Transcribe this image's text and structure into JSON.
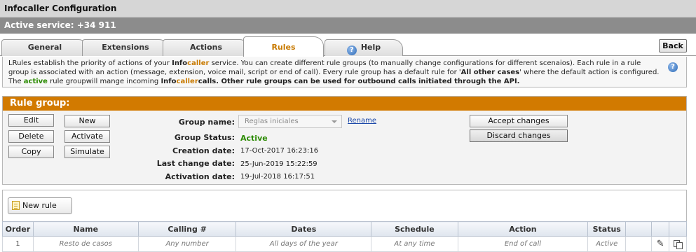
{
  "window": {
    "title": "Infocaller Configuration",
    "active_service": "Active service: +34 911"
  },
  "tabs": [
    {
      "label": "General",
      "active": false
    },
    {
      "label": "Extensions",
      "active": false
    },
    {
      "label": "Actions",
      "active": false
    },
    {
      "label": "Rules",
      "active": true
    },
    {
      "label": "Help",
      "active": false,
      "icon": "help-icon"
    }
  ],
  "back_label": "Back",
  "info": {
    "part1": "LRules establish the priority of actions of your ",
    "brand_a": "Info",
    "brand_b": "caller",
    "part2": " service. You can create different rule groups (to manually change configurations for different scenaios). Each rule in a rule group is associated with an action (message, extension, voice mail, script or end of call). Every rule group has a default rule for '",
    "bold1": "All other cases",
    "part3": "' where the default action is configured. The ",
    "active_word": "active",
    "part4": " rule groupwill mange incoming ",
    "brand_a2": "Info",
    "brand_b2": "caller",
    "bold2": "calls. Other rule groups can be used for outbound calls initiated through the API."
  },
  "rule_group": {
    "header": "Rule group:",
    "buttons": {
      "edit": "Edit",
      "new": "New",
      "delete": "Delete",
      "activate": "Activate",
      "copy": "Copy",
      "simulate": "Simulate",
      "accept": "Accept changes",
      "discard": "Discard changes"
    },
    "labels": {
      "group_name": "Group name:",
      "group_status": "Group Status:",
      "creation_date": "Creation date:",
      "last_change_date": "Last change date:",
      "activation_date": "Activation date:"
    },
    "group_name_value": "Reglas iniciales",
    "rename_label": "Rename",
    "group_status_value": "Active",
    "creation_date_value": "17-Oct-2017 16:23:16",
    "last_change_date_value": "25-Jun-2019 15:22:59",
    "activation_date_value": "19-Jul-2018 16:17:51",
    "status_color": "#2a8a00"
  },
  "rules": {
    "new_rule_label": "New rule",
    "columns": [
      "Order",
      "Name",
      "Calling #",
      "Dates",
      "Schedule",
      "Action",
      "Status",
      "",
      "",
      ""
    ],
    "rows": [
      {
        "order": "1",
        "name": "Resto de casos",
        "calling": "Any number",
        "dates": "All days of the year",
        "schedule": "At any time",
        "action": "End of call",
        "status": "Active"
      }
    ]
  },
  "colors": {
    "accent_orange": "#d27a00",
    "active_tab_text": "#c87a00",
    "service_bar": "#8c8c8c"
  }
}
